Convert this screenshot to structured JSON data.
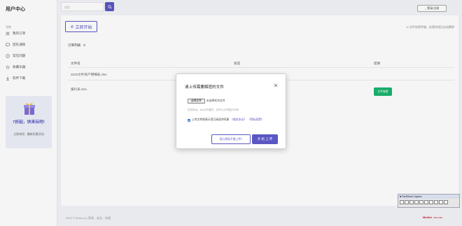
{
  "sidebar": {
    "brand": "用户中心",
    "section": "导航",
    "items": [
      {
        "label": "我的订单",
        "icon": "list-icon"
      },
      {
        "label": "团队通知",
        "icon": "message-icon"
      },
      {
        "label": "常见问题",
        "icon": "question-icon"
      },
      {
        "label": "收藏乐器",
        "icon": "star-icon"
      },
      {
        "label": "软件下载",
        "icon": "download-icon"
      }
    ],
    "promo": {
      "title": "7折起，快来玩吧!",
      "subtitle": "立即体验 · 最新优惠活动"
    }
  },
  "topbar": {
    "search_placeholder": "搜索",
    "login_label": "登录/注册"
  },
  "main": {
    "start_label": "立即开始",
    "security_note": "文件加密传输，处理完成后自动删除",
    "list_title": "订单列表",
    "list_count": "0",
    "columns": [
      "文件名",
      "状态",
      "结果"
    ],
    "rows": [
      {
        "name": "2020文件资产明细表.xlsx",
        "status": "",
        "result": ""
      },
      {
        "name": "报价表.xlsx",
        "status": "",
        "result": "文件查看"
      }
    ]
  },
  "modal": {
    "title": "请上传需要解密的文件",
    "choose_label": "选择文件",
    "no_file_label": "未选择任何文件",
    "hint": "仅支持xls、xlsx文件格式，文件大小不超过20MB",
    "agree_text": "上传文件即表示您已阅读并同意",
    "agree_link1": "《服务协议》",
    "agree_link2": "《隐私政策》",
    "cant_upload_label": "担心隐私不敢上传?",
    "upload_label": "开 始 上 传"
  },
  "footer": {
    "copyright": "2022 © 56xls.cn | 简易、安全、快速",
    "mcafee_brand": "McAfee",
    "mcafee_sub": "SECURE"
  },
  "faststone": {
    "title": "FastStone Capture"
  },
  "colors": {
    "accent": "#5b57c2",
    "success": "#19b36f",
    "mcafee": "#c8102e"
  }
}
